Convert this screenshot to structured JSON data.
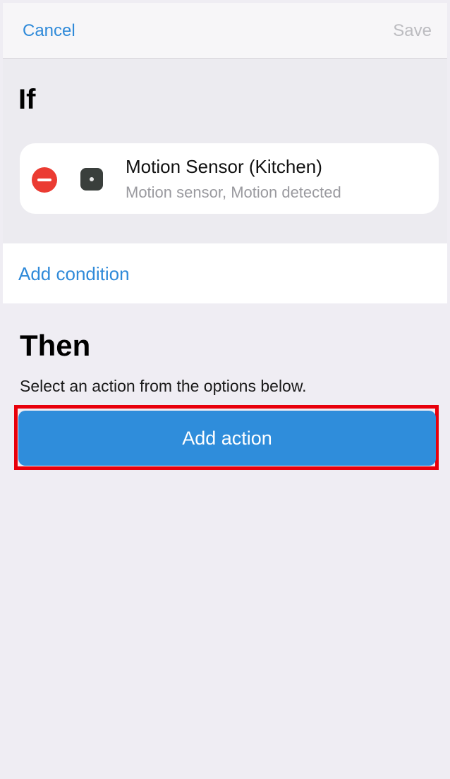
{
  "nav": {
    "cancel_label": "Cancel",
    "save_label": "Save"
  },
  "if_section": {
    "title": "If",
    "trigger": {
      "title": "Motion Sensor (Kitchen)",
      "subtitle": "Motion sensor, Motion detected",
      "icon": "motion-sensor-icon"
    },
    "add_condition_label": "Add condition"
  },
  "then_section": {
    "title": "Then",
    "description": "Select an action from the options below.",
    "add_action_label": "Add action"
  },
  "colors": {
    "accent": "#2f8ad9",
    "button": "#2f8ddb",
    "remove": "#eb3b32",
    "highlight": "#e8000b",
    "background": "#efedf3"
  }
}
